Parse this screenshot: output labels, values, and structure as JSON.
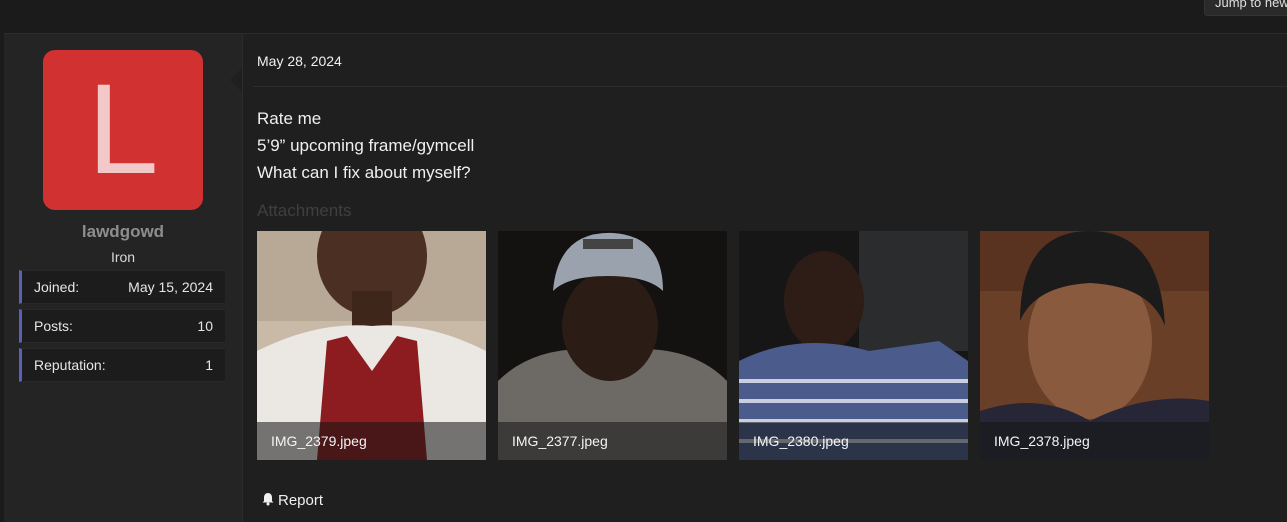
{
  "topbar": {
    "jump_label": "Jump to new"
  },
  "user": {
    "avatar_letter": "L",
    "username": "lawdgowd",
    "rank": "Iron",
    "stats": [
      {
        "label": "Joined:",
        "value": "May 15, 2024"
      },
      {
        "label": "Posts:",
        "value": "10"
      },
      {
        "label": "Reputation:",
        "value": "1"
      }
    ]
  },
  "post": {
    "date": "May 28, 2024",
    "lines": [
      "Rate me",
      "5’9” upcoming frame/gymcell",
      "What can I fix about myself?"
    ],
    "attachments_label": "Attachments",
    "attachments": [
      {
        "filename": "IMG_2379.jpeg"
      },
      {
        "filename": "IMG_2377.jpeg"
      },
      {
        "filename": "IMG_2380.jpeg"
      },
      {
        "filename": "IMG_2378.jpeg"
      }
    ],
    "report_label": "Report"
  },
  "colors": {
    "avatar_bg": "#d13231",
    "stat_accent": "#5a5fb8"
  },
  "icons": {
    "report": "bell-icon"
  }
}
